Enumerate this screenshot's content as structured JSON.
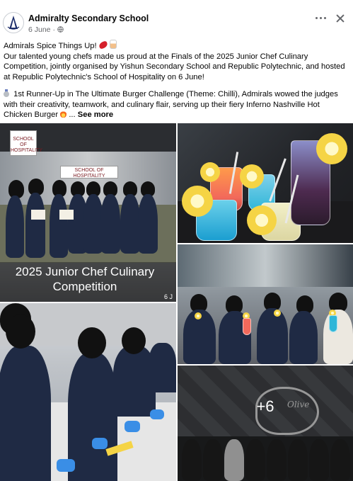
{
  "post": {
    "page_name": "Admiralty Secondary School",
    "date": "6 June",
    "privacy_icon": "globe-icon",
    "menu_icon": "more-dots-icon",
    "close_icon": "close-icon"
  },
  "caption": {
    "line1": "Admirals Spice Things Up! ",
    "line2": "Our talented young chefs made us proud at the Finals of the 2025 Junior Chef Culinary Competition, jointly organised by Yishun Secondary School and Republic Polytechnic, and hosted at Republic Polytechnic's School of Hospitality on 6 June!",
    "line3": " 1st Runner-Up in The Ultimate Burger Challenge (Theme: Chilli), Admirals wowed the judges with their creativity, teamwork, and culinary flair, serving up their fiery Inferno Nashville Hot Chicken Burger ",
    "ellipsis": "... ",
    "see_more": "See more"
  },
  "photos": {
    "tile1_sign_top": "SCHOOL OF HOSPITALITY",
    "tile1_sign_bottom": "SCHOOL OF HOSPITALITY",
    "tile1_overlay": "2025 Junior Chef Culinary Competition",
    "tile1_date": "6 J",
    "tile5_logo": "Olive",
    "more_count": "+6"
  },
  "colors": {
    "text_primary": "#050505",
    "text_secondary": "#65676b",
    "uniform_navy": "#1f2a44",
    "skirt_grey": "#8a8478"
  }
}
